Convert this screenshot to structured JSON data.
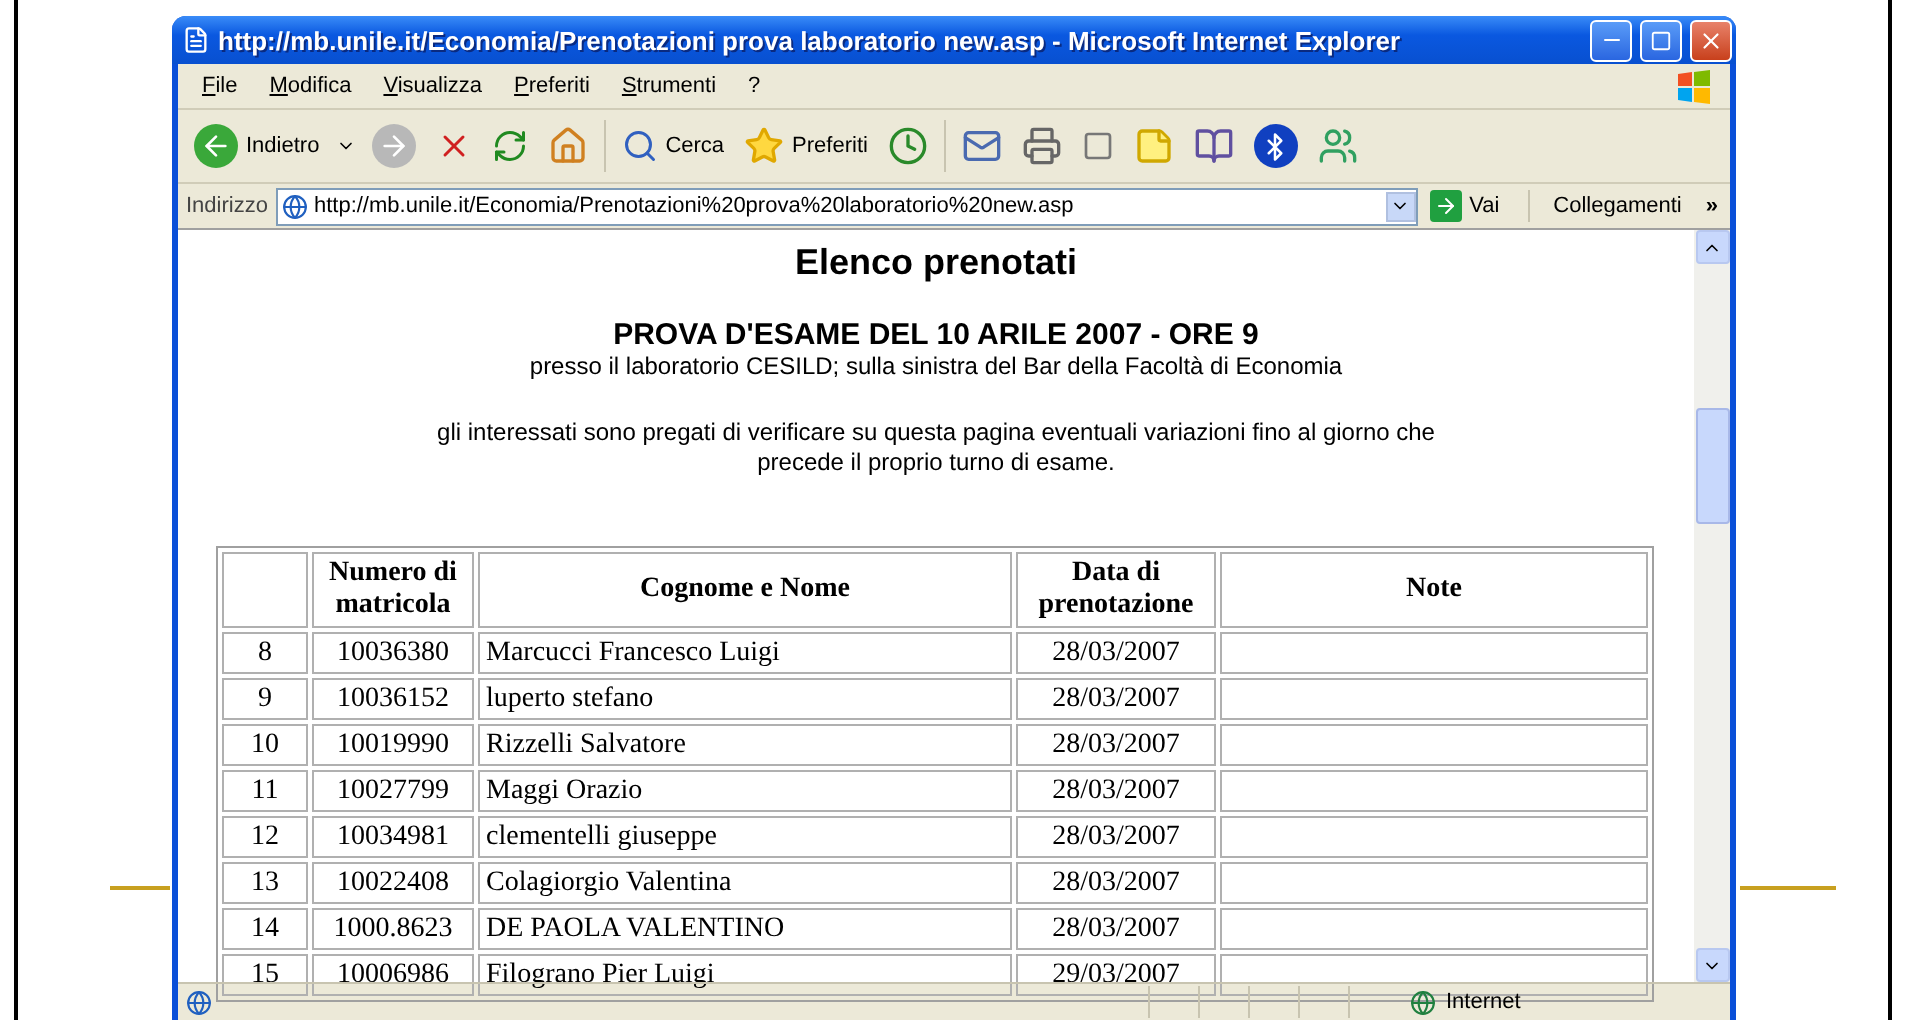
{
  "window": {
    "title": "http://mb.unile.it/Economia/Prenotazioni prova laboratorio new.asp - Microsoft Internet Explorer"
  },
  "menu": [
    "File",
    "Modifica",
    "Visualizza",
    "Preferiti",
    "Strumenti",
    "?"
  ],
  "toolbar": {
    "back": "Indietro",
    "forward_disabled": true,
    "search": "Cerca",
    "favorites": "Preferiti"
  },
  "address_bar": {
    "label": "Indirizzo",
    "url": "http://mb.unile.it/Economia/Prenotazioni%20prova%20laboratorio%20new.asp",
    "go": "Vai",
    "links": "Collegamenti",
    "more": "»"
  },
  "page": {
    "title": "Elenco prenotati",
    "heading": "PROVA D'ESAME DEL 10 ARILE 2007 - ORE 9",
    "location": "presso il laboratorio CESILD; sulla sinistra del Bar della Facoltà di Economia",
    "notice": "gli interessati sono pregati di verificare su questa pagina eventuali variazioni fino al giorno che precede il proprio turno di esame.",
    "table": {
      "columns": [
        "Numero di matricola",
        "Cognome e Nome",
        "Data di prenotazione",
        "Note"
      ],
      "rows": [
        {
          "n": "8",
          "matricola": "10036380",
          "name": "Marcucci Francesco Luigi",
          "date": "28/03/2007"
        },
        {
          "n": "9",
          "matricola": "10036152",
          "name": "luperto stefano",
          "date": "28/03/2007"
        },
        {
          "n": "10",
          "matricola": "10019990",
          "name": "Rizzelli Salvatore",
          "date": "28/03/2007"
        },
        {
          "n": "11",
          "matricola": "10027799",
          "name": "Maggi Orazio",
          "date": "28/03/2007"
        },
        {
          "n": "12",
          "matricola": "10034981",
          "name": "clementelli giuseppe",
          "date": "28/03/2007"
        },
        {
          "n": "13",
          "matricola": "10022408",
          "name": "Colagiorgio Valentina",
          "date": "28/03/2007"
        },
        {
          "n": "14",
          "matricola": "1000.8623",
          "name": "DE PAOLA VALENTINO",
          "date": "28/03/2007"
        },
        {
          "n": "15",
          "matricola": "10006986",
          "name": "Filograno Pier Luigi",
          "date": "29/03/2007"
        }
      ]
    }
  },
  "status_bar": {
    "zone": "Internet"
  }
}
